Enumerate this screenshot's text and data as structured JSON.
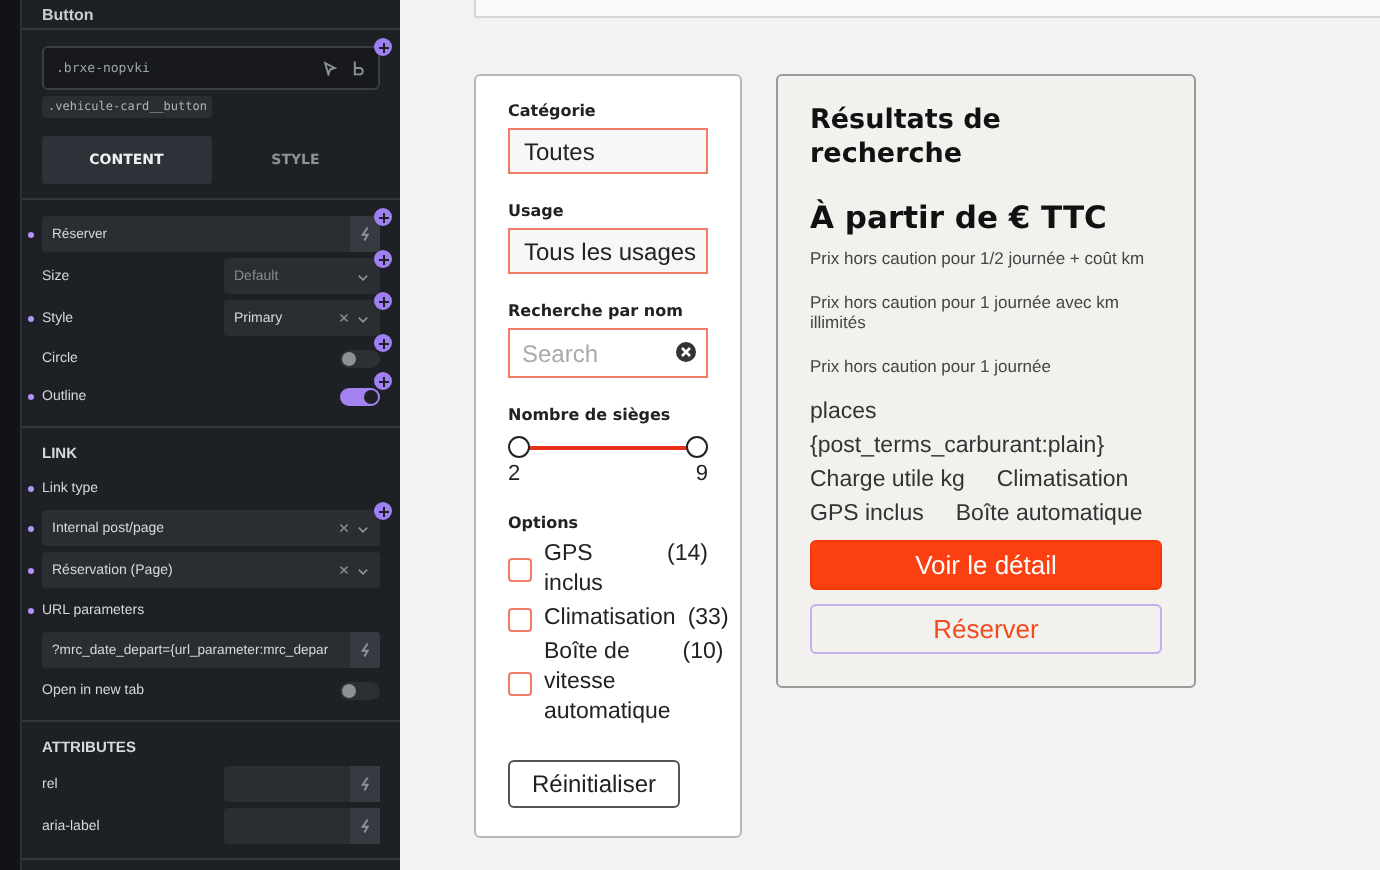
{
  "panel": {
    "title": "Button",
    "css_class": ".brxe-nopvki",
    "tag": ".vehicule-card__button",
    "tabs": [
      {
        "label": "CONTENT",
        "selected": true
      },
      {
        "label": "STYLE",
        "selected": false
      }
    ],
    "controls": [
      {
        "kind": "text",
        "value": "Réserver",
        "modified": true,
        "plus": true
      },
      {
        "kind": "select",
        "label": "Size",
        "placeholder": "Default",
        "clearable": false,
        "modified": false,
        "plus": true
      },
      {
        "kind": "select",
        "label": "Style",
        "value": "Primary",
        "clearable": true,
        "modified": true,
        "plus": true
      },
      {
        "kind": "toggle",
        "label": "Circle",
        "on": false,
        "modified": false,
        "plus": true
      },
      {
        "kind": "toggle",
        "label": "Outline",
        "on": true,
        "modified": true,
        "plus": true
      }
    ],
    "sections": [
      {
        "title": "LINK",
        "controls": [
          {
            "kind": "label",
            "label": "Link type",
            "modified": true,
            "plus": false
          },
          {
            "kind": "wideselect",
            "value": "Internal post/page",
            "clearable": true,
            "modified": true,
            "plus": true
          },
          {
            "kind": "wideselect",
            "value": "Réservation (Page)",
            "clearable": true,
            "modified": true,
            "plus": false
          },
          {
            "kind": "label",
            "label": "URL parameters",
            "modified": true,
            "plus": false
          },
          {
            "kind": "text",
            "value": "?mrc_date_depart={url_parameter:mrc_depar",
            "modified": false,
            "plus": false
          },
          {
            "kind": "toggle",
            "label": "Open in new tab",
            "on": false,
            "modified": false,
            "plus": false
          }
        ]
      },
      {
        "title": "ATTRIBUTES",
        "controls": [
          {
            "kind": "attr",
            "label": "rel",
            "modified": false,
            "plus": false
          },
          {
            "kind": "attr",
            "label": "aria-label",
            "modified": false,
            "plus": false
          }
        ]
      }
    ]
  },
  "filters": {
    "fields": [
      {
        "label": "Catégorie",
        "kind": "select",
        "value": "Toutes"
      },
      {
        "label": "Usage",
        "kind": "select",
        "value": "Tous les usages"
      },
      {
        "label": "Recherche par nom",
        "kind": "search",
        "placeholder": "Search"
      }
    ],
    "range": {
      "label": "Nombre de sièges",
      "min": "2",
      "max": "9",
      "handles": [
        {
          "level": 0
        },
        {
          "level": 1
        }
      ]
    },
    "options_title": "Options",
    "options": [
      {
        "label": "GPS inclus",
        "count": "(14)",
        "checked": false
      },
      {
        "label": "Climatisation",
        "count": "(33)",
        "checked": false
      },
      {
        "label": "Boîte de vitesse automatique",
        "count": "(10)",
        "checked": false
      }
    ],
    "reset": "Réinitialiser"
  },
  "results": {
    "title": "Résultats de recherche",
    "price": "À partir de € TTC",
    "notes": [
      "Prix hors caution pour 1/2 journée + coût km",
      "Prix hors caution pour 1 journée avec km illimités",
      "Prix hors caution pour 1 journée"
    ],
    "features": [
      [
        "places"
      ],
      [
        "{post_terms_carburant:plain}"
      ],
      [
        "Charge utile kg",
        "Climatisation"
      ],
      [
        "GPS inclus",
        "Boîte automatique"
      ]
    ],
    "primary_button": "Voir le détail",
    "secondary_button": "Réserver"
  }
}
